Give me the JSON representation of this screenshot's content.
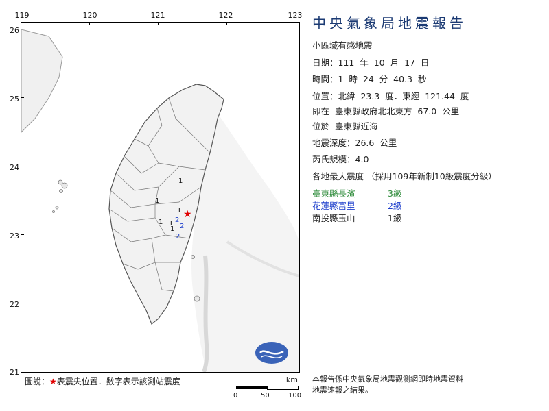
{
  "map": {
    "lon_labels": [
      "119",
      "120",
      "121",
      "122",
      "123"
    ],
    "lat_labels": [
      "26",
      "25",
      "24",
      "23",
      "22",
      "21"
    ],
    "station_marks": [
      {
        "value": "1",
        "color": "#111111"
      },
      {
        "value": "1",
        "color": "#111111"
      },
      {
        "value": "1",
        "color": "#111111"
      },
      {
        "value": "1",
        "color": "#111111"
      },
      {
        "value": "1",
        "color": "#111111"
      },
      {
        "value": "1",
        "color": "#111111"
      },
      {
        "value": "2",
        "color": "#1e3fcc"
      },
      {
        "value": "2",
        "color": "#1e3fcc"
      },
      {
        "value": "2",
        "color": "#1e3fcc"
      }
    ],
    "epicenter_symbol": "★",
    "logo_icon": "cwb-logo"
  },
  "report": {
    "title": "中央氣象局地震報告",
    "type": "小區域有感地震",
    "date_label": "日期：",
    "date_value": "111  年  10  月  17  日",
    "time_label": "時間：",
    "time_value": "1  時  24  分  40.3  秒",
    "location_label": "位置：",
    "location_value": "北緯  23.3  度．東經  121.44  度",
    "relative_label": "即在",
    "relative_value": "臺東縣政府北北東方  67.0  公里",
    "region_label": "位於",
    "region_value": "臺東縣近海",
    "depth_label": "地震深度：",
    "depth_value": "26.6  公里",
    "magnitude_label": "芮氏規模：",
    "magnitude_value": "4.0",
    "intensity_heading": "各地最大震度 （採用109年新制10級震度分級）",
    "intensities": [
      {
        "site": "臺東縣長濱",
        "level": "3級",
        "color": "#2e8b3a"
      },
      {
        "site": "花蓮縣富里",
        "level": "2級",
        "color": "#1e3fcc"
      },
      {
        "site": "南投縣玉山",
        "level": "1級",
        "color": "#222222"
      }
    ]
  },
  "legend": {
    "prefix": "圖說：",
    "star": "★",
    "text": "表震央位置．數字表示該測站震度"
  },
  "scale": {
    "unit": "km",
    "labels": [
      "0",
      "50",
      "100"
    ]
  },
  "note": {
    "line1": "本報告係中央氣象局地震觀測網即時地震資料",
    "line2": "地震速報之結果。"
  }
}
